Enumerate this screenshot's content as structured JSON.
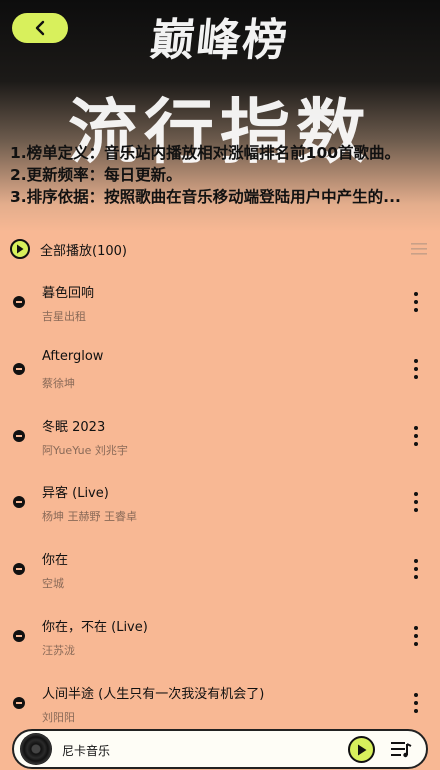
{
  "header": {
    "brand": "巅峰榜",
    "title": "流行指数",
    "description": [
      "1.榜单定义：音乐站内播放相对涨幅排名前100首歌曲。",
      "2.更新频率：每日更新。",
      "3.排序依据：按照歌曲在音乐移动端登陆用户中产生的..."
    ]
  },
  "play_all": {
    "label": "全部播放(100)"
  },
  "songs": [
    {
      "title": "暮色回响",
      "artist": "吉星出租"
    },
    {
      "title": "Afterglow",
      "artist": "蔡徐坤"
    },
    {
      "title": "冬眠 2023",
      "artist": "阿YueYue 刘兆宇"
    },
    {
      "title": "异客 (Live)",
      "artist": "杨坤 王赫野 王睿卓"
    },
    {
      "title": "你在",
      "artist": "空城"
    },
    {
      "title": "你在，不在 (Live)",
      "artist": "汪苏泷"
    },
    {
      "title": "人间半途 (人生只有一次我没有机会了)",
      "artist": "刘阳阳"
    }
  ],
  "player": {
    "title": "尼卡音乐"
  },
  "colors": {
    "accent": "#d8f05c",
    "background": "#f8b894",
    "header_dark": "#0d0d0d"
  },
  "icons": {
    "back": "chevron-left-icon",
    "play_all": "play-circle-icon",
    "list_settings": "list-settings-icon",
    "song_marker": "minus-circle-icon",
    "more": "more-vertical-icon",
    "disc": "vinyl-disc-icon",
    "play": "play-icon",
    "playlist": "playlist-icon"
  }
}
